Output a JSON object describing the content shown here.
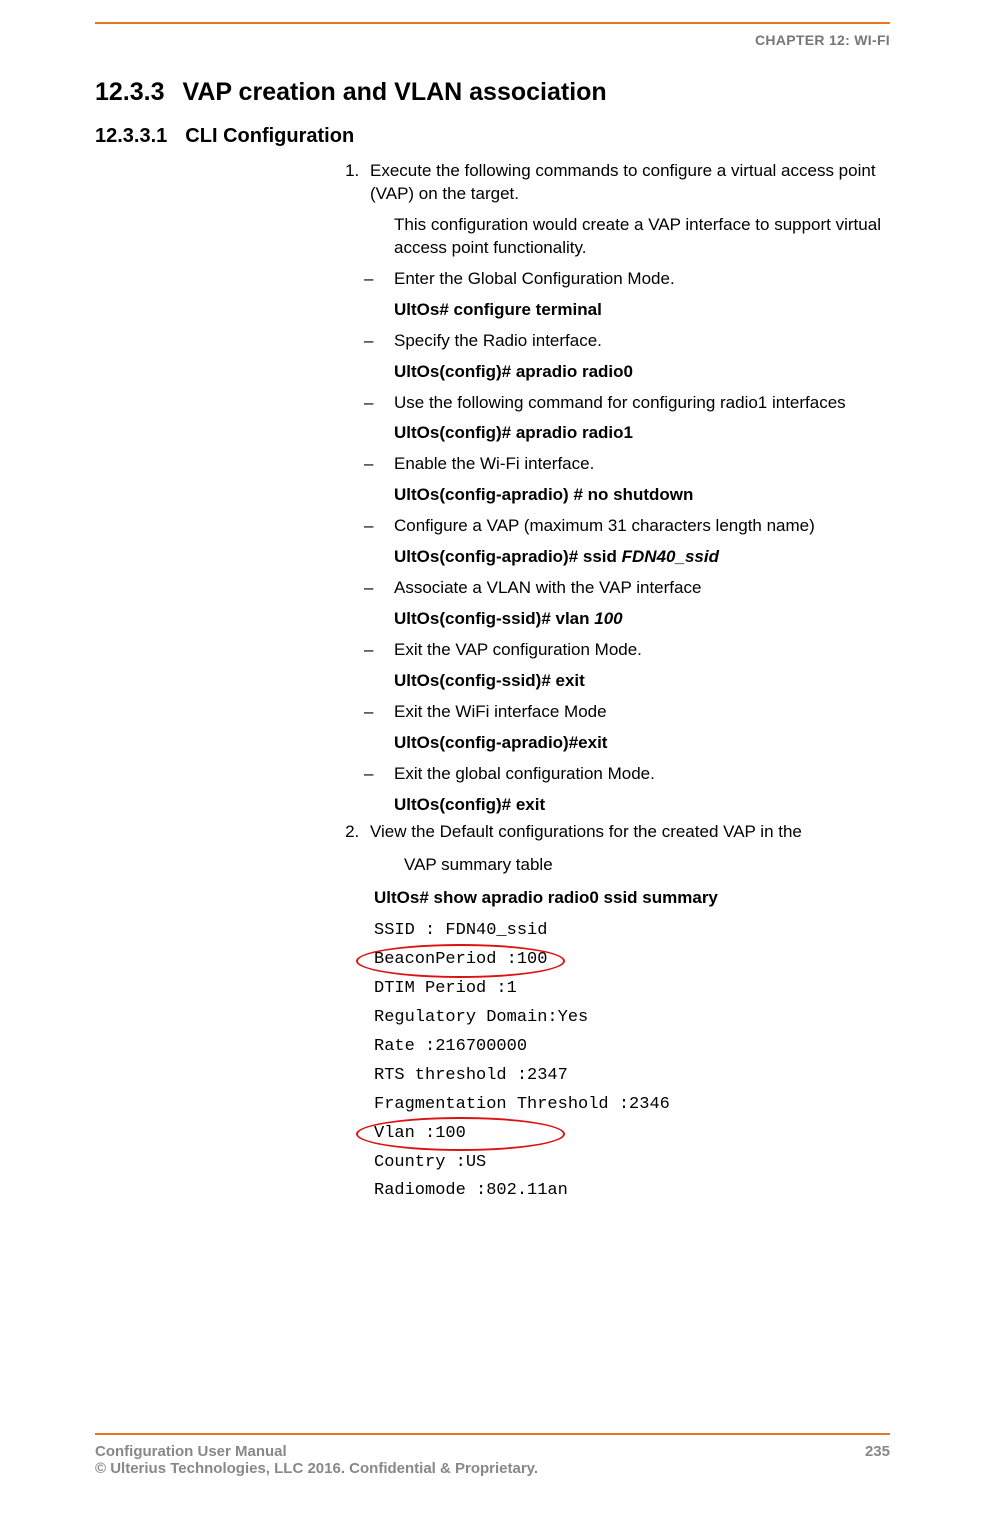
{
  "header": {
    "chapter": "CHAPTER 12: WI-FI"
  },
  "section": {
    "number": "12.3.3",
    "title": "VAP creation and VLAN association"
  },
  "subsection": {
    "number": "12.3.3.1",
    "title": "CLI Configuration"
  },
  "step1": {
    "text": "Execute the following commands to configure a virtual access point (VAP) on the target.",
    "note": "This configuration would create a VAP interface to support virtual access point functionality.",
    "items": [
      {
        "text": "Enter the Global Configuration Mode.",
        "cmd": "UltOs# configure terminal"
      },
      {
        "text": "Specify the Radio interface.",
        "cmd": "UltOs(config)# apradio radio0"
      },
      {
        "text": "Use the following command for configuring radio1 interfaces",
        "cmd": "UltOs(config)# apradio radio1"
      },
      {
        "text": "Enable the Wi-Fi interface.",
        "cmd": "UltOs(config-apradio) # no shutdown"
      },
      {
        "text": "Configure a VAP (maximum 31 characters length name)",
        "cmd": "UltOs(config-apradio)# ssid ",
        "arg": "FDN40_ssid"
      },
      {
        "text": "Associate a VLAN with the VAP interface",
        "cmd": "UltOs(config-ssid)# vlan ",
        "arg": "100"
      },
      {
        "text": "Exit the VAP configuration Mode.",
        "cmd": "UltOs(config-ssid)# exit"
      },
      {
        "text": "Exit the WiFi interface Mode",
        "cmd": "UltOs(config-apradio)#exit"
      },
      {
        "text": "Exit the global configuration Mode.",
        "cmd": "UltOs(config)# exit"
      }
    ]
  },
  "step2": {
    "text": "View the Default configurations for the created VAP in the",
    "sub": "VAP summary table",
    "cmd": "UltOs# show apradio radio0 ssid summary",
    "output": [
      "SSID : FDN40_ssid",
      "BeaconPeriod :100",
      "DTIM Period :1",
      "Regulatory Domain:Yes",
      "Rate :216700000",
      "RTS threshold :2347",
      "Fragmentation Threshold :2346",
      "Vlan :100",
      "Country :US",
      "Radiomode :802.11an"
    ]
  },
  "footer": {
    "left1": "Configuration User Manual",
    "left2": "© Ulterius Technologies, LLC 2016. Confidential & Proprietary.",
    "page": "235"
  }
}
